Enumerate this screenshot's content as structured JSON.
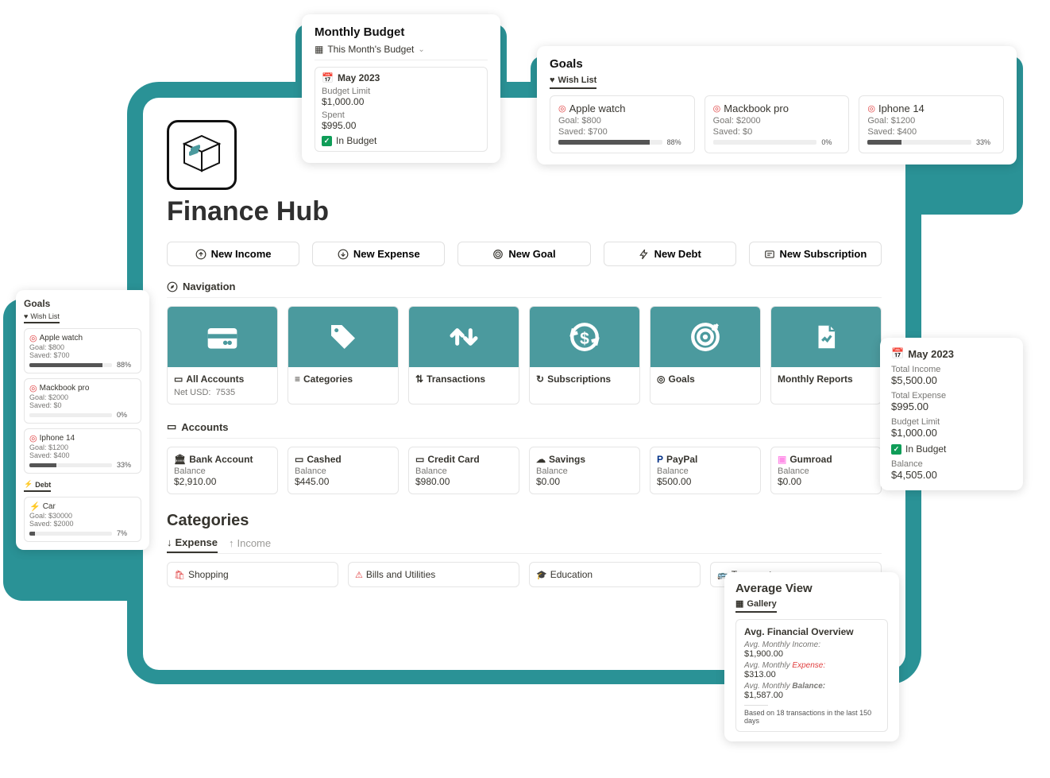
{
  "app": {
    "title": "Finance Hub"
  },
  "buttons": {
    "income": "New Income",
    "expense": "New Expense",
    "goal": "New Goal",
    "debt": "New Debt",
    "subscription": "New Subscription"
  },
  "nav": {
    "heading": "Navigation",
    "tiles": [
      {
        "name": "All Accounts",
        "sub_label": "Net USD:",
        "sub_value": "7535"
      },
      {
        "name": "Categories"
      },
      {
        "name": "Transactions"
      },
      {
        "name": "Subscriptions"
      },
      {
        "name": "Goals"
      },
      {
        "name": "Monthly Reports"
      }
    ]
  },
  "accounts": {
    "heading": "Accounts",
    "items": [
      {
        "name": "Bank Account",
        "balance_label": "Balance",
        "balance": "$2,910.00"
      },
      {
        "name": "Cashed",
        "balance_label": "Balance",
        "balance": "$445.00"
      },
      {
        "name": "Credit Card",
        "balance_label": "Balance",
        "balance": "$980.00"
      },
      {
        "name": "Savings",
        "balance_label": "Balance",
        "balance": "$0.00"
      },
      {
        "name": "PayPal",
        "balance_label": "Balance",
        "balance": "$500.00"
      },
      {
        "name": "Gumroad",
        "balance_label": "Balance",
        "balance": "$0.00"
      }
    ]
  },
  "categories": {
    "heading": "Categories",
    "tab_expense": "Expense",
    "tab_income": "Income",
    "items": [
      {
        "name": "Shopping"
      },
      {
        "name": "Bills and Utilities"
      },
      {
        "name": "Education"
      },
      {
        "name": "Transport"
      }
    ]
  },
  "budget_popup": {
    "heading": "Monthly Budget",
    "tab": "This Month's Budget",
    "date": "May 2023",
    "limit_label": "Budget Limit",
    "limit": "$1,000.00",
    "spent_label": "Spent",
    "spent": "$995.00",
    "status": "In Budget"
  },
  "goals_popup": {
    "heading": "Goals",
    "tab": "Wish List",
    "items": [
      {
        "name": "Apple watch",
        "goal_label": "Goal: $800",
        "saved_label": "Saved: $700",
        "pct": "88%",
        "pct_val": 88
      },
      {
        "name": "Mackbook pro",
        "goal_label": "Goal: $2000",
        "saved_label": "Saved: $0",
        "pct": "0%",
        "pct_val": 0
      },
      {
        "name": "Iphone 14",
        "goal_label": "Goal: $1200",
        "saved_label": "Saved: $400",
        "pct": "33%",
        "pct_val": 33
      }
    ]
  },
  "goals_sidebar": {
    "heading": "Goals",
    "tab": "Wish List",
    "items": [
      {
        "name": "Apple watch",
        "goal_label": "Goal: $800",
        "saved_label": "Saved: $700",
        "pct": "88%",
        "pct_val": 88
      },
      {
        "name": "Mackbook pro",
        "goal_label": "Goal: $2000",
        "saved_label": "Saved: $0",
        "pct": "0%",
        "pct_val": 0
      },
      {
        "name": "Iphone 14",
        "goal_label": "Goal: $1200",
        "saved_label": "Saved: $400",
        "pct": "33%",
        "pct_val": 33
      }
    ],
    "debt_tab": "Debt",
    "debt": {
      "name": "Car",
      "goal_label": "Goal: $30000",
      "saved_label": "Saved: $2000",
      "pct": "7%",
      "pct_val": 7
    }
  },
  "summary_popup": {
    "date": "May 2023",
    "total_income_label": "Total Income",
    "total_income": "$5,500.00",
    "total_expense_label": "Total Expense",
    "total_expense": "$995.00",
    "budget_limit_label": "Budget Limit",
    "budget_limit": "$1,000.00",
    "status": "In Budget",
    "balance_label": "Balance",
    "balance": "$4,505.00"
  },
  "average_popup": {
    "heading": "Average View",
    "tab": "Gallery",
    "block_title": "Avg. Financial Overview",
    "income_label": "Avg. Monthly Income:",
    "income": "$1,900.00",
    "expense_label": "Avg. Monthly Expense:",
    "expense": "$313.00",
    "balance_label": "Avg. Monthly Balance:",
    "balance": "$1,587.00",
    "footer": "Based on 18 transactions in the last 150 days"
  }
}
